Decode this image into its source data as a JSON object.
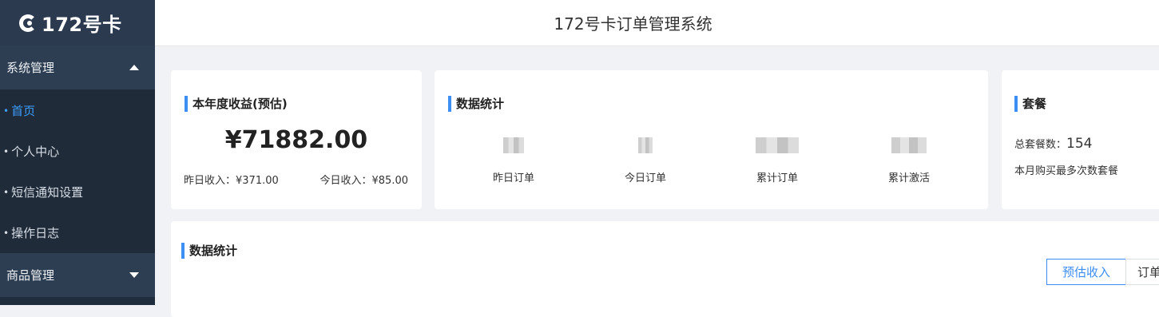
{
  "app": {
    "logo_text": "172号卡",
    "title": "172号卡订单管理系统"
  },
  "sidebar": {
    "groups": [
      {
        "label": "系统管理",
        "expanded": true
      },
      {
        "label": "商品管理",
        "expanded": false
      }
    ],
    "items": [
      {
        "label": "首页",
        "active": true
      },
      {
        "label": "个人中心",
        "active": false
      },
      {
        "label": "短信通知设置",
        "active": false
      },
      {
        "label": "操作日志",
        "active": false
      }
    ],
    "bullet": "•"
  },
  "revenue": {
    "title": "本年度收益(预估)",
    "amount": "¥71882.00",
    "yesterday": "昨日收入：¥371.00",
    "today": "今日收入：¥85.00"
  },
  "stats": {
    "title": "数据统计",
    "items": [
      {
        "label": "昨日订单"
      },
      {
        "label": "今日订单"
      },
      {
        "label": "累计订单"
      },
      {
        "label": "累计激活"
      }
    ]
  },
  "package": {
    "title": "套餐",
    "total_label": "总套餐数：",
    "total_value": "154",
    "note": "本月购买最多次数套餐"
  },
  "chart_section": {
    "title": "数据统计",
    "tabs": [
      {
        "label": "预估收入",
        "active": true
      },
      {
        "label": "订单",
        "active": false
      }
    ]
  },
  "colors": {
    "accent": "#3c8ef3",
    "sidebar_bg": "#1f2d3d",
    "active_item": "#3c9cff"
  }
}
